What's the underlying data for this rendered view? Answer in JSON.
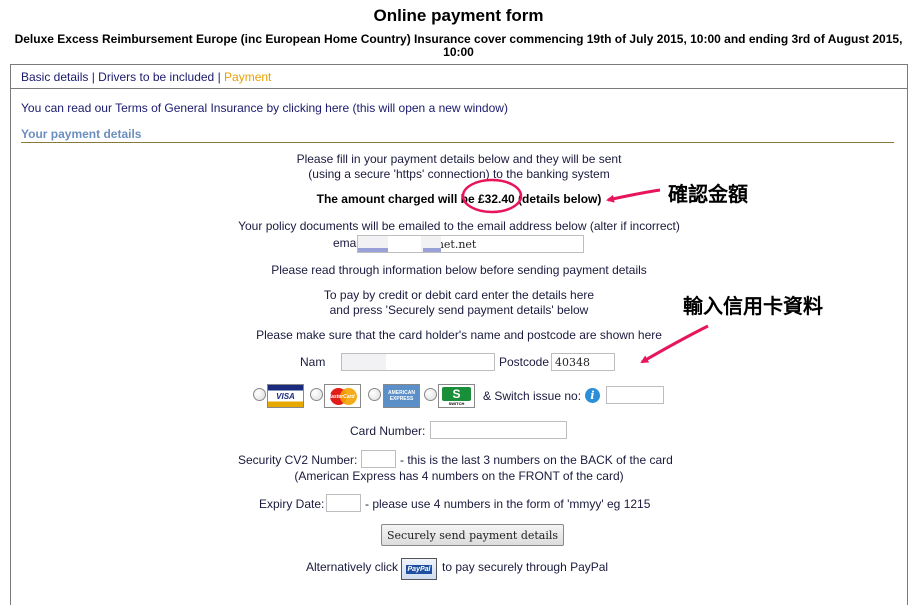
{
  "page": {
    "title": "Online payment form",
    "subtitle": "Deluxe Excess Reimbursement Europe (inc European Home Country) Insurance cover commencing 19th of July 2015, 10:00 and ending 3rd of August 2015, 10:00"
  },
  "nav": {
    "basic": "Basic details",
    "sep1": " | ",
    "drivers": "Drivers to be included",
    "sep2": " | ",
    "payment": "Payment"
  },
  "intro": {
    "before": "You can read our Terms of General Insurance by ",
    "link": "clicking here",
    "after": " (this will open a new window)"
  },
  "section": {
    "heading": "Your payment details"
  },
  "form": {
    "fill_line1": "Please fill in your payment details below and they will be sent",
    "fill_line2": "(using a secure 'https' connection) to the banking system",
    "amount_text": "The amount charged will be £32.40 (details below)",
    "email_note": "Your policy documents will be emailed to the email address below (alter if incorrect)",
    "email_label": "ema",
    "email_value": "8@r            hinet.net",
    "read_note": "Please read through information below before sending payment details",
    "card_line1": "To pay by credit or debit card enter the details here",
    "card_line2": "and press 'Securely send payment details' below",
    "holder_note": "Please make sure that the card holder's name and postcode are shown here",
    "name_label": "Nam",
    "name_value": "hang",
    "postcode_label": "Postcode",
    "postcode_value": "40348",
    "switch_label": "& Switch issue no:",
    "card_number_label": "Card Number:",
    "cv2_label": "Security CV2 Number:",
    "cv2_note1": "- this is the last 3 numbers on the BACK of the card",
    "cv2_note2": "(American Express has 4 numbers on the FRONT of the card)",
    "expiry_label": "Expiry Date:",
    "expiry_note": "- please use 4 numbers in the form of 'mmyy' eg 1215",
    "submit_label": "Securely send payment details",
    "paypal_before": "Alternatively click",
    "paypal_after": "to pay securely through PayPal",
    "cards": {
      "visa": "VISA",
      "mastercard": "MasterCard",
      "amex": "AMERICAN EXPRESS",
      "switch_logo": "S",
      "switch_word": "SWITCH"
    },
    "paypal_logo": "PayPal",
    "info_glyph": "i"
  },
  "annotations": {
    "confirm_amount": "確認金額",
    "enter_card": "輸入信用卡資料",
    "color": "#e8155a"
  }
}
